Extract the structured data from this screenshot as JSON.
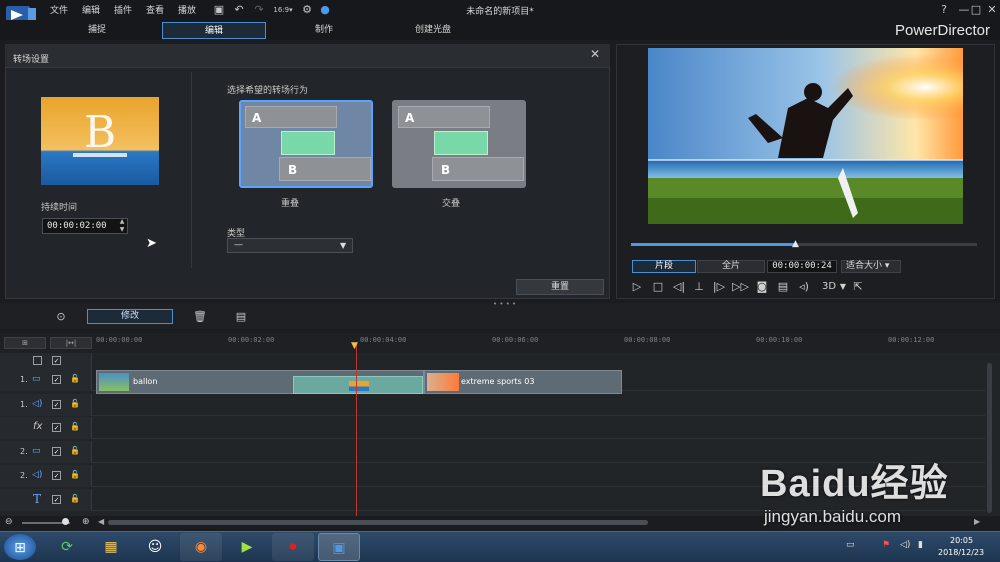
{
  "titlebar": {
    "menus": [
      "文件",
      "编辑",
      "插件",
      "查看",
      "播放"
    ],
    "document_title": "未命名的新项目*",
    "help": "?",
    "minimize": "—",
    "maximize": "□",
    "close": "✕"
  },
  "modes": {
    "tabs": [
      "捕捉",
      "编辑",
      "制作",
      "创建光盘"
    ],
    "active": "编辑",
    "brand": "PowerDirector"
  },
  "transition_panel": {
    "title": "转场设置",
    "duration_label": "持续时间",
    "duration_value": "00:00:02:00",
    "behavior_label": "选择希望的转场行为",
    "options": [
      {
        "label": "重叠",
        "a": "A",
        "b": "B",
        "selected": true
      },
      {
        "label": "交叠",
        "a": "A",
        "b": "B",
        "selected": false
      }
    ],
    "type_label": "类型",
    "type_value": "—",
    "reset_label": "重置",
    "preview_letter": "B"
  },
  "preview": {
    "segment_clip": "片段",
    "segment_full": "全片",
    "timecode": "00:00:00:24",
    "fit": "适合大小",
    "mode_3d": "3D",
    "progress": 0.48
  },
  "toolbar": {
    "modify_label": "修改"
  },
  "timeline": {
    "ruler": [
      "00:00:00:00",
      "00:00:02:00",
      "00:00:04:00",
      "00:00:06:00",
      "00:00:08:00",
      "00:00:10:00",
      "00:00:12:00"
    ],
    "tracks": [
      {
        "num": "1.",
        "kind": "video"
      },
      {
        "num": "1.",
        "kind": "audio"
      },
      {
        "num": "",
        "kind": "fx"
      },
      {
        "num": "2.",
        "kind": "video"
      },
      {
        "num": "2.",
        "kind": "audio"
      },
      {
        "num": "",
        "kind": "title"
      }
    ],
    "clips": [
      {
        "name": "ballon"
      },
      {
        "name": "extreme sports 03"
      }
    ]
  },
  "taskbar": {
    "time": "20:05",
    "date": "2018/12/23"
  },
  "watermark": {
    "brand": "Baidu经验",
    "url": "jingyan.baidu.com"
  },
  "colors": {
    "accent": "#4a8fd0",
    "playhead": "#c0352f",
    "transition_green": "#78d8a8"
  }
}
